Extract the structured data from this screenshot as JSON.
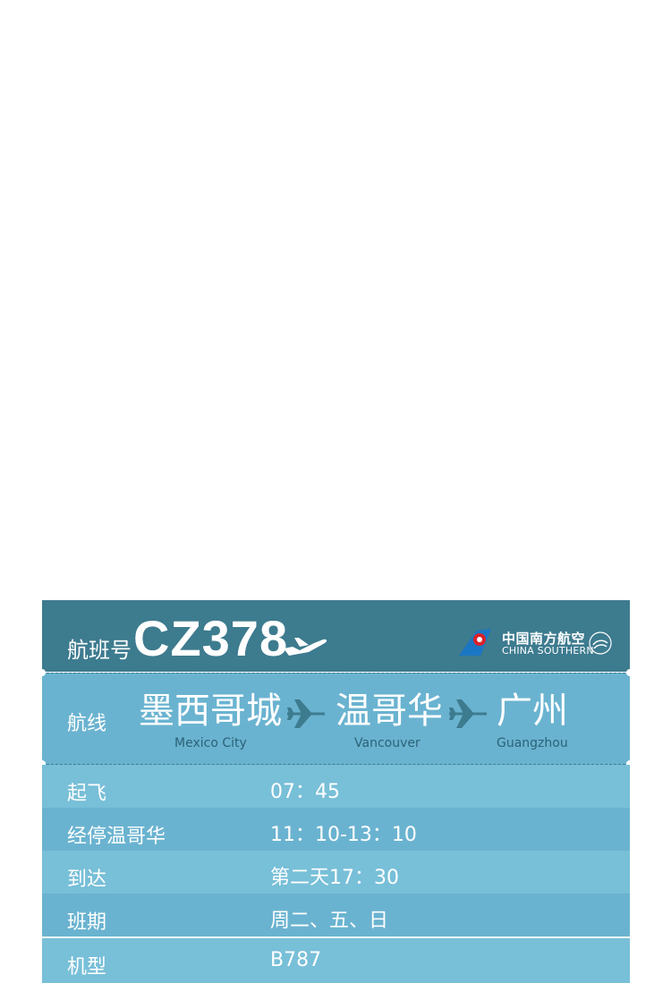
{
  "header": {
    "label": "航班号",
    "flight_number": "CZ378",
    "airline_cn": "中国南方航空",
    "airline_en": "CHINA SOUTHERN",
    "icons": [
      "plane-icon",
      "china-southern-logo-icon",
      "skyteam-icon"
    ]
  },
  "route": {
    "label": "航线",
    "stops": [
      {
        "cn": "墨西哥城",
        "en": "Mexico City"
      },
      {
        "cn": "温哥华",
        "en": "Vancouver"
      },
      {
        "cn": "广州",
        "en": "Guangzhou"
      }
    ]
  },
  "details": [
    {
      "label": "起飞",
      "value": "07：45"
    },
    {
      "label": "经停温哥华",
      "value": "11：10-13：10"
    },
    {
      "label": "到达",
      "value": "第二天17：30"
    },
    {
      "label": "班期",
      "value": "周二、五、日"
    },
    {
      "label": "机型",
      "value": "B787"
    }
  ],
  "colors": {
    "header_bg": "#3d7b8f",
    "route_bg": "#6ab3d0",
    "row_light": "#78bfd8",
    "row_dark": "#6ab3d0",
    "logo_red": "#d9222a",
    "logo_blue": "#1a76c4"
  }
}
